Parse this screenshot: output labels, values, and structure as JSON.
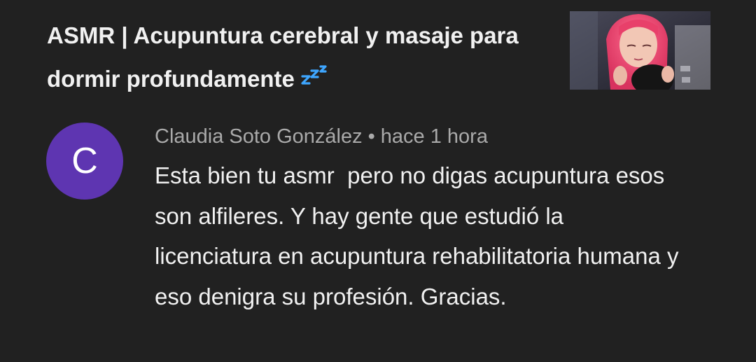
{
  "video": {
    "title": "ASMR | Acupuntura cerebral y masaje para dormir profundamente"
  },
  "comment": {
    "avatar_initial": "C",
    "author": "Claudia Soto González",
    "separator": "•",
    "time": "hace 1 hora",
    "text": "Esta bien tu asmr  pero no digas acupuntura esos son alfileres. Y hay gente que estudió la licenciatura en acupuntura rehabilitatoria humana y eso denigra su profesión. Gracias."
  },
  "colors": {
    "background": "#212121",
    "avatar": "#5e35b1",
    "zzz": "#3ea6ff"
  },
  "icons": {
    "title_emoji": "zzz-icon"
  }
}
